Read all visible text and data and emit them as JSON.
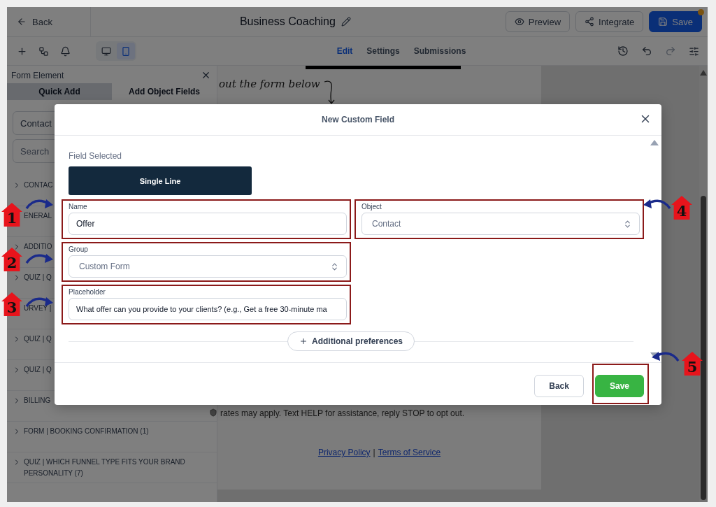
{
  "header": {
    "back": "Back",
    "title": "Business Coaching",
    "buttons": [
      {
        "label": "Preview",
        "kind": "outline"
      },
      {
        "label": "Integrate",
        "kind": "outline"
      },
      {
        "label": "Save",
        "kind": "primary"
      }
    ]
  },
  "toolbar": {
    "devices": [
      {
        "kind": "desktop",
        "selected": false
      },
      {
        "kind": "mobile",
        "selected": true
      }
    ],
    "tabs": [
      {
        "label": "Edit",
        "selected": true
      },
      {
        "label": "Settings",
        "selected": false
      },
      {
        "label": "Submissions",
        "selected": false
      }
    ]
  },
  "sidebar": {
    "title": "Form Element",
    "tabs": [
      {
        "label": "Quick Add",
        "selected": true
      },
      {
        "label": "Add Object Fields",
        "selected": false
      }
    ],
    "object_select": "Contact",
    "search": {
      "placeholder": "Search"
    },
    "groups": [
      {
        "label": "CONTAC"
      },
      {
        "label": "ENERAL"
      },
      {
        "label": "ADDITIO"
      },
      {
        "label": "QUIZ | Q"
      },
      {
        "label": "URVEY |"
      },
      {
        "label": "QUIZ | Q"
      },
      {
        "label": "QUIZ | Q"
      },
      {
        "label": "BILLING"
      },
      {
        "label": "FORM | BOOKING CONFIRMATION (1)"
      },
      {
        "label": "QUIZ | WHICH FUNNEL TYPE FITS YOUR BRAND PERSONALITY  (7)"
      }
    ]
  },
  "canvas": {
    "script_text": "out the form below",
    "disclaimer": "rates may apply. Text HELP for assistance, reply STOP to opt out.",
    "links": [
      "Privacy Policy",
      "Terms of Service"
    ],
    "separator": "|"
  },
  "modal": {
    "title": "New Custom Field",
    "field_selected_label": "Field Selected",
    "field_type": "Single Line",
    "fields": [
      {
        "label": "Name",
        "kind": "input",
        "value": "Offer",
        "outlined": true
      },
      {
        "label": "Object",
        "kind": "select",
        "value": "Contact",
        "outlined": true
      },
      {
        "label": "Group",
        "kind": "select",
        "value": "Custom Form",
        "outlined": true
      },
      {
        "label": "Placeholder",
        "kind": "input",
        "value": "What offer can you provide to your clients? (e.g., Get a free 30-minute ma",
        "outlined": true
      }
    ],
    "more": "Additional preferences",
    "buttons": [
      {
        "label": "Back",
        "kind": "secondary",
        "outlined": false
      },
      {
        "label": "Save",
        "kind": "success",
        "outlined": true
      }
    ]
  },
  "annotations": [
    {
      "number": "1"
    },
    {
      "number": "2"
    },
    {
      "number": "3"
    },
    {
      "number": "4"
    },
    {
      "number": "5"
    }
  ]
}
